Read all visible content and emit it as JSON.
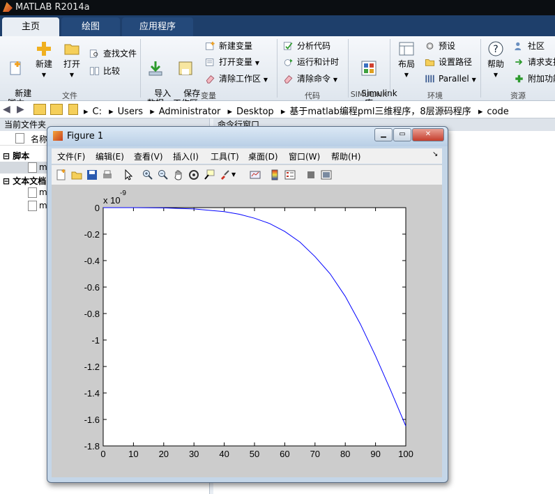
{
  "app": {
    "title": "MATLAB R2014a"
  },
  "tabs": [
    "主页",
    "绘图",
    "应用程序"
  ],
  "ribbon": {
    "new_script": "新建\n脚本",
    "new": "新建",
    "open": "打开",
    "find_files": "查找文件",
    "compare": "比较",
    "import_data": "导入\n数据",
    "save_workspace": "保存\n工作区",
    "new_variable": "新建变量",
    "open_variable": "打开变量",
    "clear_workspace": "清除工作区",
    "analyze_code": "分析代码",
    "run_and_time": "运行和计时",
    "clear_commands": "清除命令",
    "simulink_library": "Simulink\n库",
    "layout": "布局",
    "preferences": "预设",
    "set_path": "设置路径",
    "parallel": "Parallel",
    "help": "帮助",
    "community": "社区",
    "request_support": "请求支持",
    "add_ons": "附加功能",
    "group_file": "文件",
    "group_variable": "变量",
    "group_code": "代码",
    "group_simulink": "SIMULINK",
    "group_env": "环境",
    "group_resources": "资源"
  },
  "address": [
    "C:",
    "Users",
    "Administrator",
    "Desktop",
    "基于matlab编程pml三维程序，8层源码程序",
    "code"
  ],
  "current_folder": {
    "header": "当前文件夹",
    "name_col": "名称",
    "group_scripts": "脚本",
    "group_text": "文本文档",
    "file_prefix_1": "m",
    "file_prefix_2": "m",
    "file_prefix_3": "m"
  },
  "command_window": {
    "header": "命令行窗口"
  },
  "figure": {
    "title": "Figure 1",
    "menu": [
      "文件(F)",
      "编辑(E)",
      "查看(V)",
      "插入(I)",
      "工具(T)",
      "桌面(D)",
      "窗口(W)",
      "帮助(H)"
    ]
  },
  "chart_data": {
    "type": "line",
    "title": "",
    "xlabel": "",
    "ylabel": "",
    "exponent_label": "x 10",
    "exponent_power": "-9",
    "xlim": [
      0,
      100
    ],
    "ylim": [
      -1.8,
      0
    ],
    "xticks": [
      0,
      10,
      20,
      30,
      40,
      50,
      60,
      70,
      80,
      90,
      100
    ],
    "yticks": [
      0,
      -0.2,
      -0.4,
      -0.6,
      -0.8,
      -1,
      -1.2,
      -1.4,
      -1.6,
      -1.8
    ],
    "ytick_labels": [
      "0",
      "-0.2",
      "-0.4",
      "-0.6",
      "-0.8",
      "-1",
      "-1.2",
      "-1.4",
      "-1.6",
      "-1.8"
    ],
    "grid": false,
    "line_color": "#0000ff",
    "series": [
      {
        "x": [
          0,
          10,
          20,
          30,
          40,
          45,
          50,
          55,
          60,
          65,
          70,
          75,
          80,
          85,
          90,
          95,
          100
        ],
        "y": [
          0,
          0,
          -0.002,
          -0.01,
          -0.03,
          -0.05,
          -0.08,
          -0.12,
          -0.18,
          -0.26,
          -0.37,
          -0.5,
          -0.67,
          -0.88,
          -1.12,
          -1.38,
          -1.65
        ]
      }
    ]
  }
}
